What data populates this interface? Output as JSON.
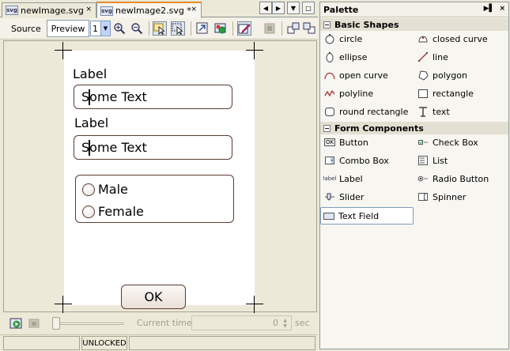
{
  "tabs": [
    {
      "label": "newImage.svg",
      "close": "×",
      "icon": "svg-file-icon"
    },
    {
      "label": "newImage2.svg *",
      "close": "×",
      "icon": "svg-file-icon"
    }
  ],
  "nav": {
    "left": "◀",
    "right": "▶",
    "menu": "▼",
    "restore": "□"
  },
  "toolbar": {
    "source_label": "Source",
    "preview_label": "Preview",
    "zoom_value": "1",
    "zoom_arrow": "▼"
  },
  "canvas": {
    "label1": "Label",
    "field1_before": "S",
    "field1_after": "ome Text",
    "label2": "Label",
    "field2_before": "S",
    "field2_after": "ome Text",
    "radio1": "Male",
    "radio2": "Female",
    "ok": "OK"
  },
  "timeline": {
    "current_time_label": "Current time:",
    "time_value": "0",
    "spin_up": "▲",
    "spin_down": "▼",
    "unit": "sec"
  },
  "status": {
    "lock": "UNLOCKED"
  },
  "palette": {
    "title": "Palette",
    "ctrl_pin": "▶▌",
    "ctrl_close": "×",
    "categories": [
      {
        "label": "Basic Shapes",
        "toggle": "−"
      },
      {
        "label": "Form Components",
        "toggle": "−"
      }
    ],
    "basic_shapes": [
      {
        "label": "circle",
        "icon": "circle-icon"
      },
      {
        "label": "closed curve",
        "icon": "closed-curve-icon"
      },
      {
        "label": "ellipse",
        "icon": "ellipse-icon"
      },
      {
        "label": "line",
        "icon": "line-icon"
      },
      {
        "label": "open curve",
        "icon": "open-curve-icon"
      },
      {
        "label": "polygon",
        "icon": "polygon-icon"
      },
      {
        "label": "polyline",
        "icon": "polyline-icon"
      },
      {
        "label": "rectangle",
        "icon": "rectangle-icon"
      },
      {
        "label": "round rectangle",
        "icon": "round-rectangle-icon"
      },
      {
        "label": "text",
        "icon": "text-icon"
      }
    ],
    "form_components": [
      {
        "label": "Button",
        "icon": "button-icon",
        "icon_text": "OK"
      },
      {
        "label": "Check Box",
        "icon": "checkbox-icon"
      },
      {
        "label": "Combo Box",
        "icon": "combobox-icon"
      },
      {
        "label": "List",
        "icon": "list-icon"
      },
      {
        "label": "Label",
        "icon": "label-icon",
        "icon_text": "label"
      },
      {
        "label": "Radio Button",
        "icon": "radio-button-icon"
      },
      {
        "label": "Slider",
        "icon": "slider-icon"
      },
      {
        "label": "Spinner",
        "icon": "spinner-icon"
      },
      {
        "label": "Text Field",
        "icon": "text-field-icon"
      }
    ],
    "selected_item": "Text Field"
  },
  "colors": {
    "accent_tab": "#e68b2c",
    "component_border": "#5c3c32",
    "panel_bg": "#ece9d8",
    "selection_border": "#7f9db9"
  }
}
